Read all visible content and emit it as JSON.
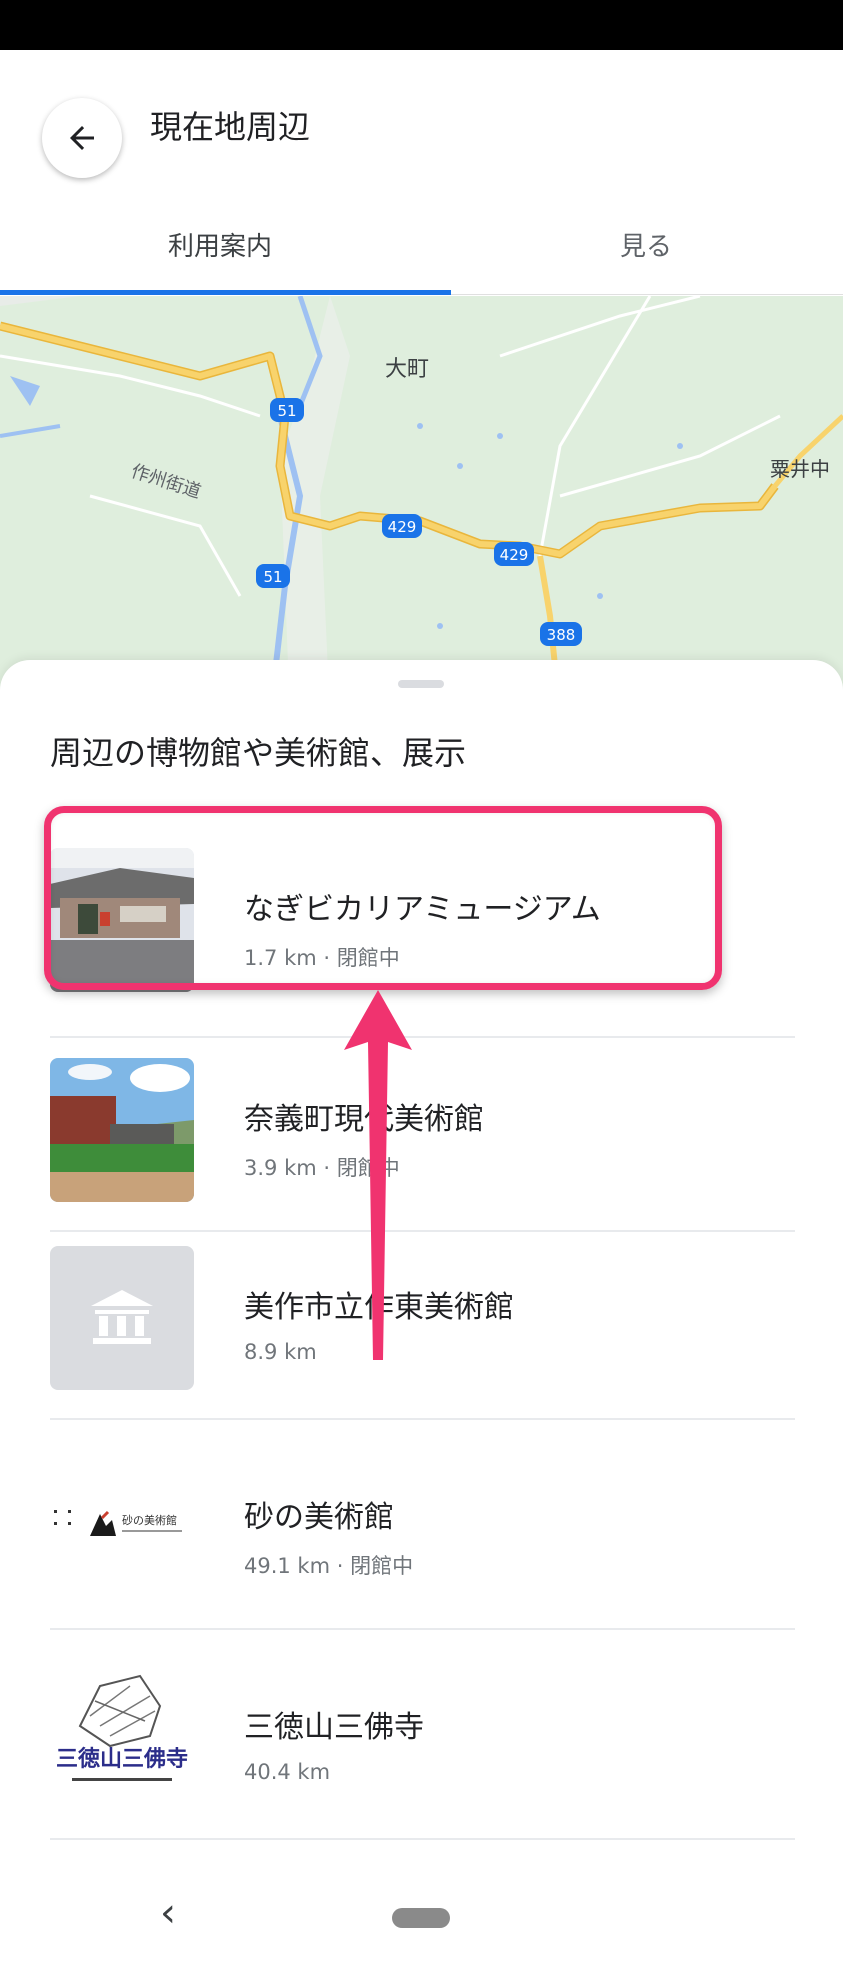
{
  "header": {
    "back_icon": "arrow-back-icon",
    "title": "現在地周辺",
    "tabs": [
      {
        "label": "利用案内",
        "active": true
      },
      {
        "label": "見る",
        "active": false
      }
    ]
  },
  "map": {
    "labels": {
      "town": "大町",
      "street": "作州街道",
      "place": "粟井中"
    },
    "route_markers": [
      "51",
      "429",
      "429",
      "51",
      "388"
    ]
  },
  "sheet": {
    "title": "周辺の博物館や美術館、展示",
    "items": [
      {
        "name": "なぎビカリアミュージアム",
        "meta": "1.7 km · 閉館中"
      },
      {
        "name": "奈義町現代美術館",
        "meta": "3.9 km · 閉館中"
      },
      {
        "name": "美作市立作東美術館",
        "meta": "8.9 km"
      },
      {
        "name": "砂の美術館",
        "meta": "49.1 km · 閉館中"
      },
      {
        "name": "三徳山三佛寺",
        "meta": "40.4 km"
      }
    ],
    "logo_texts": {
      "sand": "砂の美術館",
      "temple": "三徳山三佛寺"
    }
  },
  "annotation": {
    "highlight_color": "#f0336f",
    "arrow_icon": "up-arrow-icon"
  },
  "nav": {
    "back_icon": "chevron-left-icon",
    "home_icon": "home-pill-icon"
  },
  "colors": {
    "accent": "#1a73e8",
    "road": "#f5c64f",
    "map_bg": "#dfeedd"
  }
}
